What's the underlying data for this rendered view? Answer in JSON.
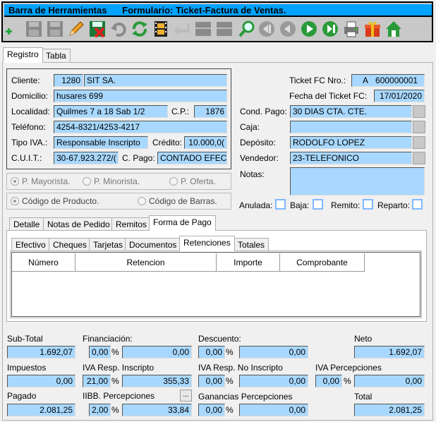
{
  "toolbar": {
    "title": "Barra de Herramientas",
    "form_title": "Formulario: Ticket-Factura de Ventas."
  },
  "tabs": [
    "Registro",
    "Tabla"
  ],
  "cliente": {
    "label": "Cliente:",
    "code": "1280",
    "name": "SIT SA."
  },
  "domicilio": {
    "label": "Domicilio:",
    "value": "husares  699"
  },
  "localidad": {
    "label": "Localidad:",
    "value": "Quilmes 7 a 18 Sab 1/2",
    "cp_label": "C.P.:",
    "cp": "1876"
  },
  "telefono": {
    "label": "Teléfono:",
    "value": "4254-8321/4253-4217"
  },
  "tipo_iva": {
    "label": "Tipo IVA.:",
    "value": "Responsable Inscripto",
    "credito_label": "Crédito:",
    "credito": "10.000,0("
  },
  "cuit": {
    "label": "C.U.I.T.:",
    "value": "30-67.923.272/(",
    "cpago_label": "C. Pago:",
    "cpago": "CONTADO EFEC"
  },
  "ticket": {
    "nro_label": "Ticket FC Nro.:",
    "nro_letter": "A",
    "nro": "600000001",
    "fecha_label": "Fecha del Ticket FC:",
    "fecha": "17/01/2020"
  },
  "cond_pago": {
    "label": "Cond. Pago:",
    "value": "30 DIAS CTA. CTE."
  },
  "caja": {
    "label": "Caja:",
    "value": ""
  },
  "deposito": {
    "label": "Depósito:",
    "value": "RODOLFO LOPEZ"
  },
  "vendedor": {
    "label": "Vendedor:",
    "value": "23-TELEFONICO"
  },
  "notas": {
    "label": "Notas:",
    "value": ""
  },
  "precio": {
    "mayorista": "P. Mayorista.",
    "minorista": "P. Minorista.",
    "oferta": "P. Oferta."
  },
  "codigo": {
    "producto": "Código de Producto.",
    "barras": "Código de Barras."
  },
  "flags": {
    "anulada": "Anulada:",
    "baja": "Baja:",
    "remito": "Remito:",
    "reparto": "Reparto:"
  },
  "detail_tabs": [
    "Detalle",
    "Notas de Pedido",
    "Remitos",
    "Forma de Pago"
  ],
  "pay_tabs": [
    "Efectivo",
    "Cheques",
    "Tarjetas",
    "Documentos",
    "Retenciones",
    "Totales"
  ],
  "ret_cols": [
    "Número",
    "Retencion",
    "Importe",
    "Comprobante"
  ],
  "totals": {
    "subtotal_label": "Sub-Total",
    "subtotal": "1.692,07",
    "financiacion_label": "Financiación:",
    "fin_pct": "0,00",
    "fin_val": "0,00",
    "descuento_label": "Descuento:",
    "desc_pct": "0,00",
    "desc_val": "0,00",
    "neto_label": "Neto",
    "neto": "1.692,07",
    "impuestos_label": "Impuestos",
    "impuestos": "0,00",
    "iva_ri_label": "IVA Resp. Inscripto",
    "iva_ri_pct": "21,00",
    "iva_ri_val": "355,33",
    "iva_rni_label": "IVA Resp. No Inscripto",
    "iva_rni_pct": "0,00",
    "iva_rni_val": "0,00",
    "iva_perc_label": "IVA Percepciones",
    "iva_perc_pct": "0,00",
    "iva_perc_val": "0,00",
    "pagado_label": "Pagado",
    "pagado": "2.081,25",
    "iibb_label": "IIBB. Percepciones",
    "iibb_pct": "2,00",
    "iibb_val": "33,84",
    "iibb_btn": "...",
    "gan_label": "Ganancias Percepciones",
    "gan_pct": "0,00",
    "gan_val": "0,00",
    "total_label": "Total",
    "total": "2.081,25",
    "pct": "%"
  }
}
